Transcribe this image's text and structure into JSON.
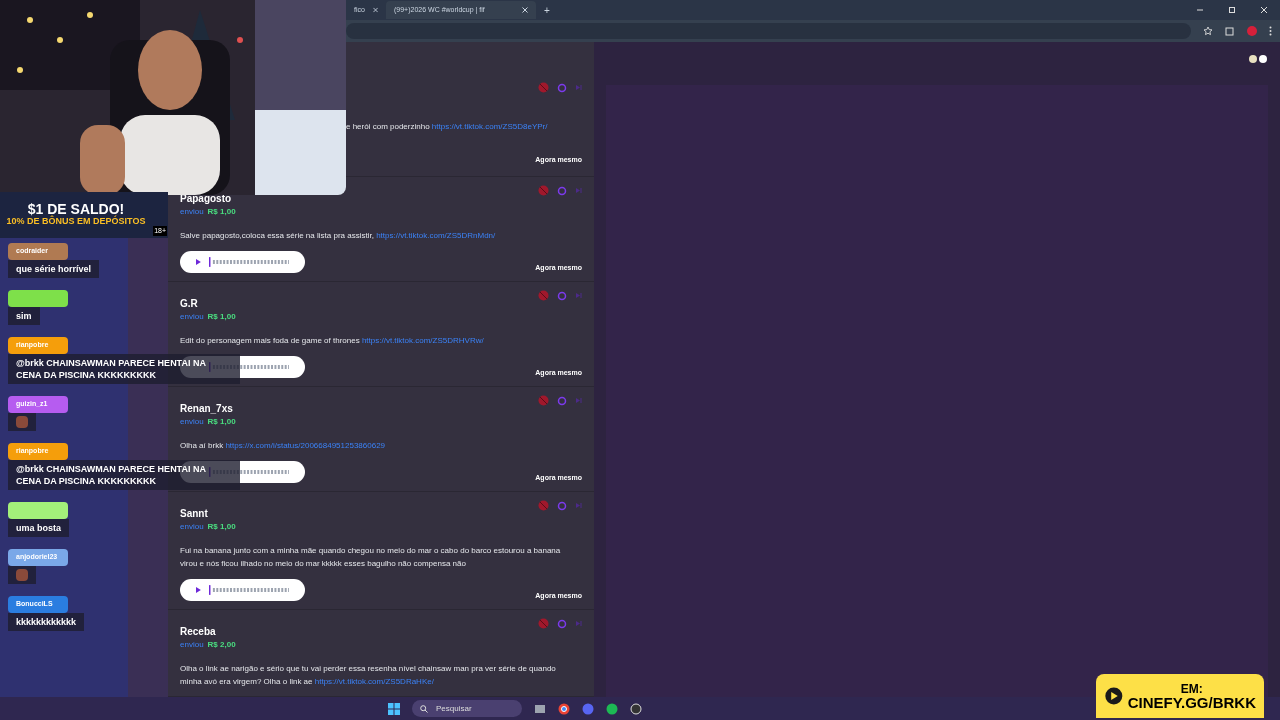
{
  "browser": {
    "tabs": [
      {
        "title": "fico",
        "selected": false
      },
      {
        "title": "(99+)2026 WC #worldcup | fif",
        "selected": true
      }
    ],
    "new_tab": "+"
  },
  "ad_banner": {
    "line_1": "$1 DE SALDO!",
    "line_2": "10% DE BÔNUS EM DEPÓSITOS",
    "age": "18+"
  },
  "chat": [
    {
      "user": "codraider",
      "color": "#b07a52",
      "message": "que série horrível",
      "kind": "text"
    },
    {
      "color": "#7ee04a",
      "message": "sim",
      "kind": "text"
    },
    {
      "user": "rianpobre",
      "color": "#f59e0b",
      "message": "@brkk CHAINSAWMAN PARECE HENTAI NA CENA DA PISCINA KKKKKKKKK",
      "kind": "text"
    },
    {
      "user": "guizin_z1",
      "color": "#b65cf0",
      "kind": "emote"
    },
    {
      "user": "rianpobre",
      "color": "#f59e0b",
      "message": "@brkk CHAINSAWMAN PARECE HENTAI NA CENA DA PISCINA KKKKKKKKK",
      "kind": "text"
    },
    {
      "color": "#a3f07a",
      "message": "uma bosta",
      "kind": "text"
    },
    {
      "user": "anjodoriel23",
      "color": "#7aa8e8",
      "kind": "emote"
    },
    {
      "user": "BonucciLS",
      "color": "#2a7de0",
      "message": "kkkkkkkkkkkk",
      "kind": "text"
    }
  ],
  "donations": [
    {
      "kind": "covered",
      "message": "e herói com poderzinho",
      "link": "https://vt.tiktok.com/ZS5D8eYPr/",
      "time": "Agora mesmo",
      "audio": false
    },
    {
      "kind": "full",
      "name": "Papagosto",
      "sent": "enviou",
      "amount": "R$ 1,00",
      "message": "Salve papagosto,coloca essa série na lista pra assistir,",
      "link": "https://vt.tiktok.com/ZS5DRnMdn/",
      "time": "Agora mesmo",
      "audio": true
    },
    {
      "kind": "full",
      "name": "G.R",
      "sent": "enviou",
      "amount": "R$ 1,00",
      "message": "Edit do personagem mais foda de game of thrones",
      "link": "https://vt.tiktok.com/ZS5DRHVRw/",
      "time": "Agora mesmo",
      "audio": true
    },
    {
      "kind": "full",
      "name": "Renan_7xs",
      "sent": "enviou",
      "amount": "R$ 1,00",
      "message": "Olha aí brkk",
      "link": "https://x.com/i/status/2006684951253860629",
      "time": "Agora mesmo",
      "audio": true
    },
    {
      "kind": "full",
      "name": "Sannt",
      "sent": "enviou",
      "amount": "R$ 1,00",
      "message": "Fui na banana junto com a minha mãe quando chegou no meio do mar o cabo do barco estourou a banana virou e nós ficou ilhado no meio do mar kkkkk esses bagulho não compensa não",
      "time": "Agora mesmo",
      "audio": true
    },
    {
      "kind": "full",
      "name": "Receba",
      "sent": "enviou",
      "amount": "R$ 2,00",
      "message": "Olha o link ae narigão e sério que tu vai perder essa resenha nível chainsaw man pra ver série de quando minha avó era virgem? Olha o link ae",
      "link": "https://vt.tiktok.com/ZS5DRaHKe/",
      "audio": false
    }
  ],
  "taskbar": {
    "search_placeholder": "Pesquisar"
  },
  "promo": {
    "line_1": "EM:",
    "line_2": "CINEFY.GG/BRKK"
  }
}
